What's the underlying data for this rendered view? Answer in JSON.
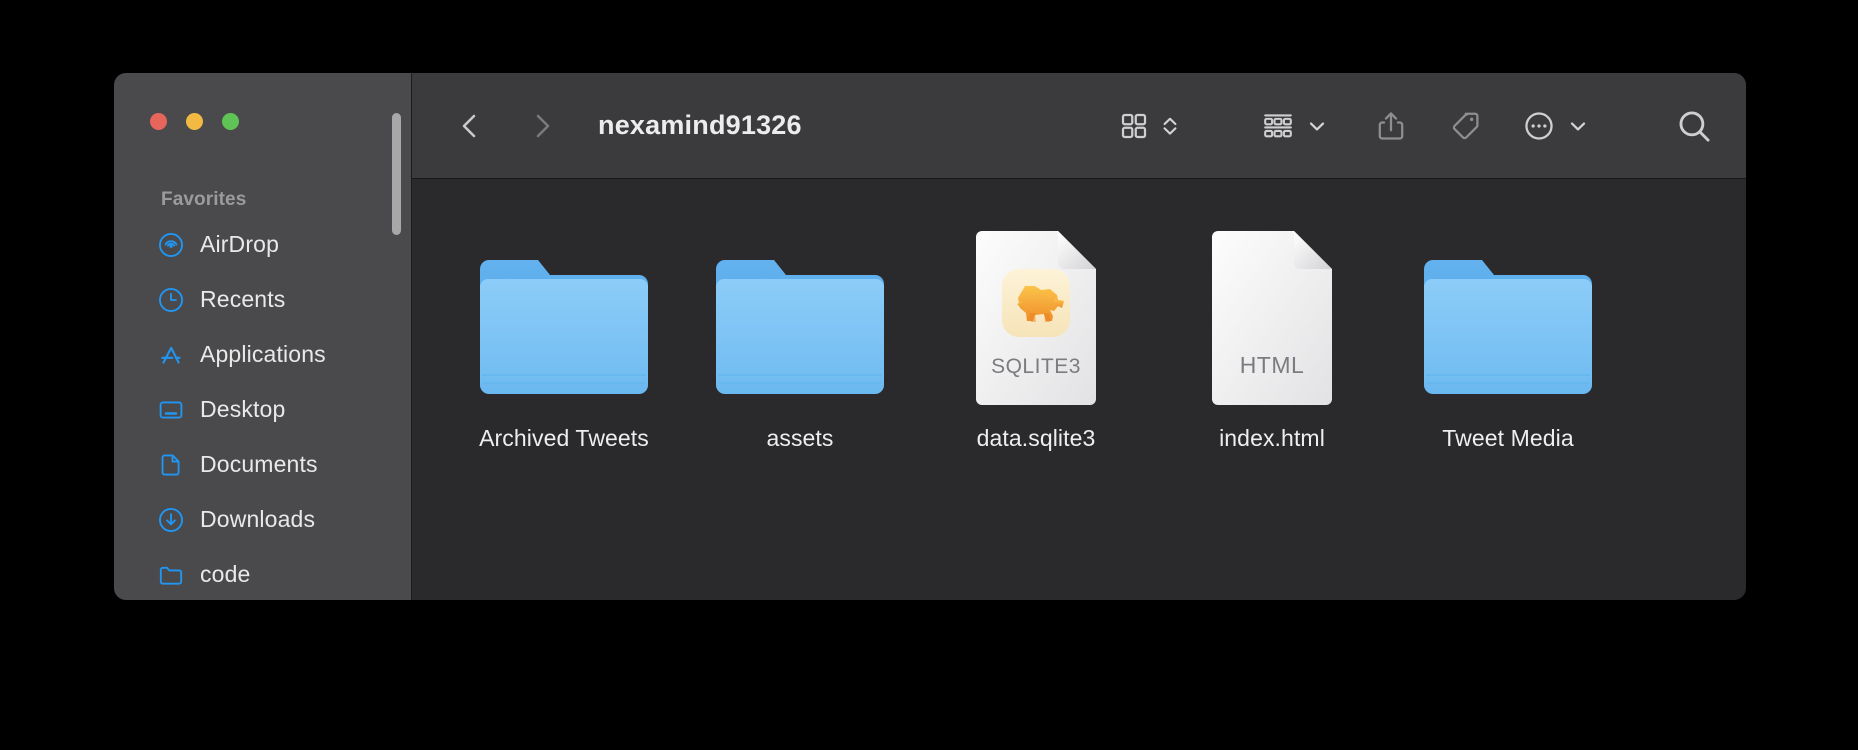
{
  "window": {
    "title": "nexamind91326",
    "traffic_lights": [
      {
        "name": "close",
        "color": "#e8655c"
      },
      {
        "name": "minimize",
        "color": "#f2ba42"
      },
      {
        "name": "zoom",
        "color": "#5fc455"
      }
    ]
  },
  "toolbar": {
    "back_icon": "chevron-left-icon",
    "forward_icon": "chevron-right-icon",
    "items": [
      {
        "name": "icon-view-button",
        "icon": "grid-view-icon"
      },
      {
        "name": "view-options-stepper",
        "icon": "chevron-up-down-icon"
      },
      {
        "name": "group-by-button",
        "icon": "group-list-icon"
      },
      {
        "name": "group-by-menu",
        "icon": "chevron-down-icon"
      },
      {
        "name": "share-button",
        "icon": "share-icon"
      },
      {
        "name": "tags-button",
        "icon": "tag-icon"
      },
      {
        "name": "more-actions-button",
        "icon": "ellipsis-circle-icon"
      },
      {
        "name": "more-actions-menu",
        "icon": "chevron-down-icon"
      },
      {
        "name": "search-button",
        "icon": "search-icon"
      }
    ]
  },
  "sidebar": {
    "section_title": "Favorites",
    "items": [
      {
        "label": "AirDrop",
        "icon": "airdrop-icon"
      },
      {
        "label": "Recents",
        "icon": "clock-icon"
      },
      {
        "label": "Applications",
        "icon": "applications-icon"
      },
      {
        "label": "Desktop",
        "icon": "desktop-icon"
      },
      {
        "label": "Documents",
        "icon": "document-icon"
      },
      {
        "label": "Downloads",
        "icon": "downloads-icon"
      },
      {
        "label": "code",
        "icon": "folder-icon"
      }
    ]
  },
  "files": [
    {
      "name": "Archived Tweets",
      "kind": "folder"
    },
    {
      "name": "assets",
      "kind": "folder"
    },
    {
      "name": "data.sqlite3",
      "kind": "document",
      "badge": "SQLITE3",
      "glyph": "elephant-icon"
    },
    {
      "name": "index.html",
      "kind": "document",
      "badge": "HTML",
      "glyph": ""
    },
    {
      "name": "Tweet Media",
      "kind": "folder"
    }
  ],
  "colors": {
    "window_toolbar": "#3b3b3d",
    "sidebar": "#4a4a4c",
    "content": "#2a2a2c",
    "accent": "#2196f3",
    "folder_front": "#7fc5f5",
    "folder_back": "#57a8e8",
    "desktop": "#000000"
  }
}
